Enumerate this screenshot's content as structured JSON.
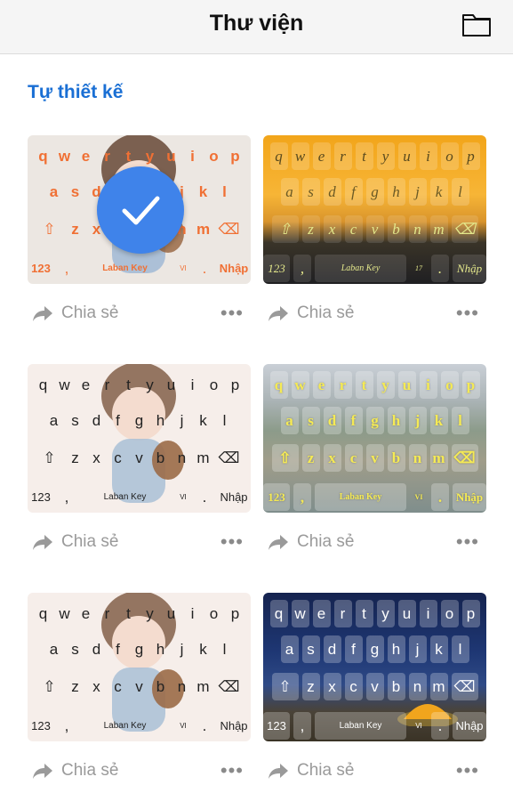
{
  "header": {
    "title": "Thư viện",
    "folder_icon": "folder-icon"
  },
  "section_title": "Tự thiết kế",
  "keyboard": {
    "row1": [
      "q",
      "w",
      "e",
      "r",
      "t",
      "y",
      "u",
      "i",
      "o",
      "p"
    ],
    "row2": [
      "a",
      "s",
      "d",
      "f",
      "g",
      "h",
      "j",
      "k",
      "l"
    ],
    "row3": [
      "z",
      "x",
      "c",
      "v",
      "b",
      "n",
      "m"
    ],
    "num_key": "123",
    "comma_key": ",",
    "space_label": "Laban Key",
    "lang_label": "VI",
    "alt_lang_label": "17",
    "enter_label": "Nhập",
    "period_key": "."
  },
  "card_action": {
    "share_label": "Chia sẻ",
    "more_label": "•••"
  },
  "themes": [
    {
      "name": "girl-orange-letters",
      "selected": true,
      "accent": "#f07034"
    },
    {
      "name": "sunset-yellow",
      "selected": false,
      "accent": "#e3e78b"
    },
    {
      "name": "girl-black-letters",
      "selected": false,
      "accent": "#222222"
    },
    {
      "name": "city-yellow",
      "selected": false,
      "accent": "#f5ea54"
    },
    {
      "name": "girl-black-letters-2",
      "selected": false,
      "accent": "#222222"
    },
    {
      "name": "night-camping",
      "selected": false,
      "accent": "#ffffff"
    }
  ],
  "colors": {
    "brand_blue": "#1a6fd4",
    "check_blue": "#3f83ea"
  }
}
